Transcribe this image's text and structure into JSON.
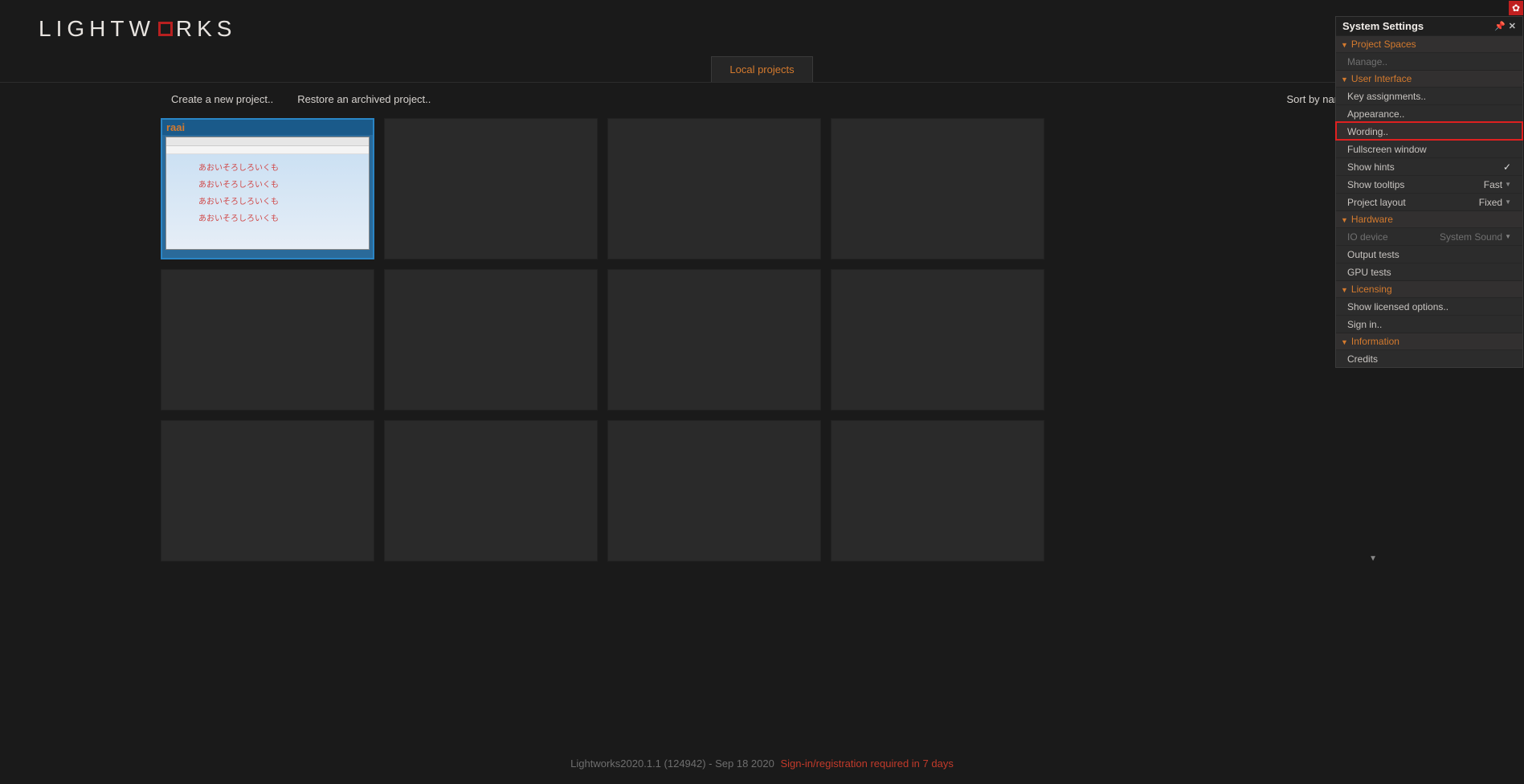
{
  "logo": {
    "left": "LIGHTW",
    "right": "RKS"
  },
  "tab_label": "Local projects",
  "toolbar": {
    "create": "Create a new project..",
    "restore": "Restore an archived project..",
    "sort_label": "Sort by name"
  },
  "project": {
    "title": "raai",
    "line1": "あおいそろしろいくも",
    "line2": "あおいそろしろいくも",
    "line3": "あおいそろしろいくも",
    "line4": "あおいそろしろいくも"
  },
  "panel": {
    "title": "System Settings",
    "sec_project_spaces": "Project Spaces",
    "manage": "Manage..",
    "sec_ui": "User Interface",
    "key_assign": "Key assignments..",
    "appearance": "Appearance..",
    "wording": "Wording..",
    "fullscreen": "Fullscreen window",
    "show_hints": "Show hints",
    "show_tooltips": "Show tooltips",
    "tooltips_val": "Fast",
    "project_layout": "Project layout",
    "project_layout_val": "Fixed",
    "sec_hardware": "Hardware",
    "io_device": "IO device",
    "io_device_val": "System Sound",
    "output_tests": "Output tests",
    "gpu_tests": "GPU tests",
    "sec_licensing": "Licensing",
    "show_licensed": "Show licensed options..",
    "sign_in": "Sign in..",
    "sec_info": "Information",
    "credits": "Credits"
  },
  "footer": {
    "version": "Lightworks2020.1.1 (124942) - Sep 18 2020",
    "warning": "Sign-in/registration required in 7 days"
  }
}
